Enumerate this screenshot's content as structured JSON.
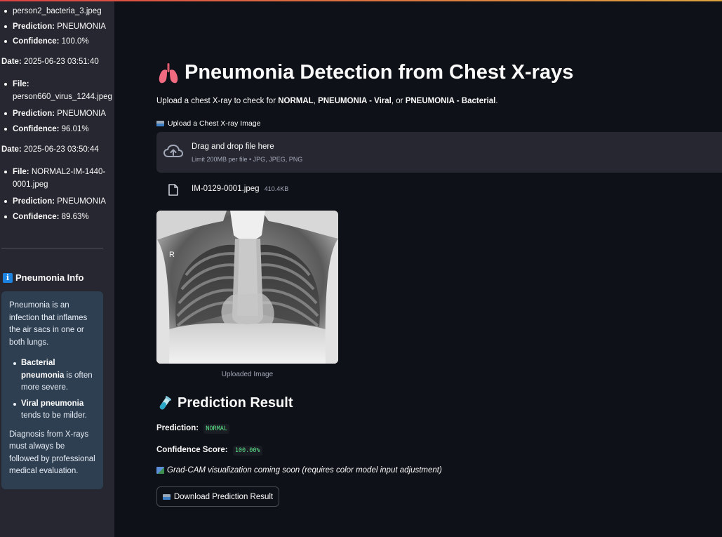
{
  "sidebar": {
    "history": [
      {
        "file_value": "person2_bacteria_3.jpeg",
        "prediction_label": "Prediction:",
        "prediction_value": "PNEUMONIA",
        "confidence_label": "Confidence:",
        "confidence_value": "100.0%"
      },
      {
        "date_label": "Date:",
        "date_value": "2025-06-23 03:51:40",
        "file_label": "File:",
        "file_value": "person660_virus_1244.jpeg",
        "prediction_label": "Prediction:",
        "prediction_value": "PNEUMONIA",
        "confidence_label": "Confidence:",
        "confidence_value": "96.01%"
      },
      {
        "date_label": "Date:",
        "date_value": "2025-06-23 03:50:44",
        "file_label": "File:",
        "file_value": "NORMAL2-IM-1440-0001.jpeg",
        "prediction_label": "Prediction:",
        "prediction_value": "PNEUMONIA",
        "confidence_label": "Confidence:",
        "confidence_value": "89.63%"
      }
    ],
    "info": {
      "icon": "info-icon",
      "title": "Pneumonia Info",
      "intro": "Pneumonia is an infection that inflames the air sacs in one or both lungs.",
      "bullets": [
        {
          "bold": "Bacterial pneumonia",
          "rest": " is often more severe."
        },
        {
          "bold": "Viral pneumonia",
          "rest": " tends to be milder."
        }
      ],
      "outro": "Diagnosis from X-rays must always be followed by professional medical evaluation."
    }
  },
  "main": {
    "title": "Pneumonia Detection from Chest X-rays",
    "title_icon": "lungs-icon",
    "subtitle": {
      "prefix": "Upload a chest X-ray to check for ",
      "opt1": "NORMAL",
      "sep1": ", ",
      "opt2": "PNEUMONIA - Viral",
      "sep2": ", or ",
      "opt3": "PNEUMONIA - Bacterial",
      "suffix": "."
    },
    "uploader": {
      "label": "Upload a Chest X-ray Image",
      "drag_text": "Drag and drop file here",
      "limit_text": "Limit 200MB per file • JPG, JPEG, PNG",
      "file_name": "IM-0129-0001.jpeg",
      "file_size": "410.4KB"
    },
    "image_caption": "Uploaded Image",
    "xray_marker": "R",
    "result": {
      "heading": "Prediction Result",
      "heading_icon": "test-tube-icon",
      "prediction_label": "Prediction:",
      "prediction_value": "NORMAL",
      "confidence_label": "Confidence Score:",
      "confidence_value": "100.00%",
      "gradcam_note": "Grad-CAM visualization coming soon (requires color model input adjustment)",
      "download_label": "Download Prediction Result"
    }
  },
  "colors": {
    "app_bg": "#0e1117",
    "sidebar_bg": "#262730",
    "info_box_bg": "#2e3f52",
    "code_green": "#5ce488",
    "accent_blue": "#1c83e1"
  }
}
